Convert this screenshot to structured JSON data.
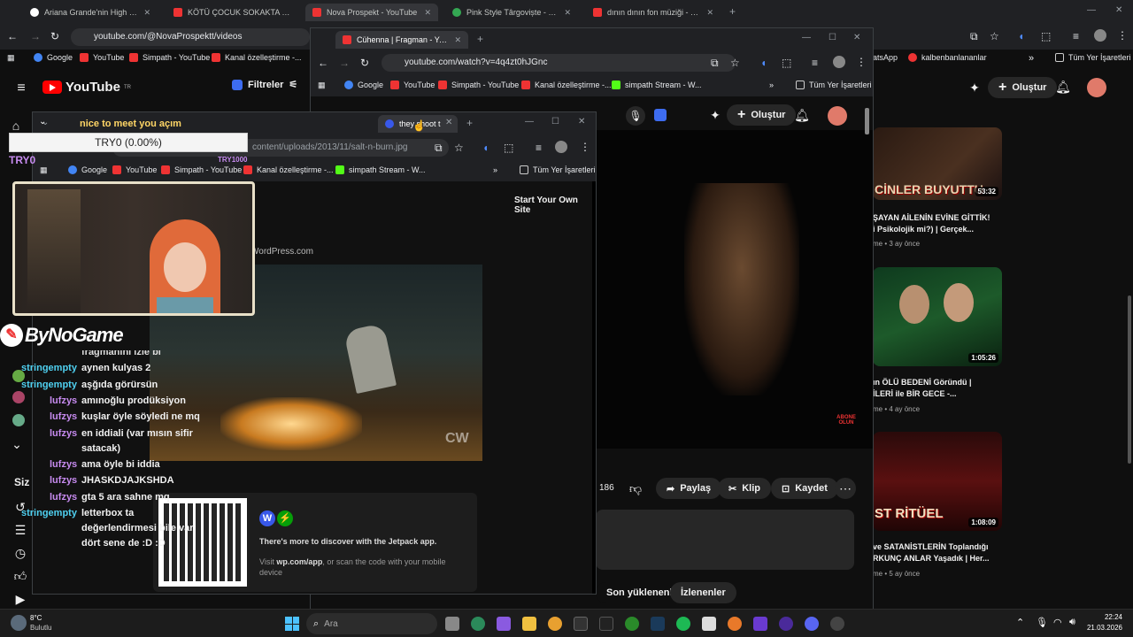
{
  "tabs": [
    {
      "label": "Ariana Grande'nin High Note P"
    },
    {
      "label": "KÖTÜ ÇOCUK SOKAKTA VE TAF"
    },
    {
      "label": "Nova Prospekt - YouTube"
    },
    {
      "label": "Pink Style Târgoviște - Google I"
    },
    {
      "label": "dının dının fon müziği - YouTub"
    }
  ],
  "main_url": "youtube.com/@NovaProspektt/videos",
  "bookmarks": [
    "Google",
    "YouTube",
    "Simpath - YouTube",
    "Kanal özelleştirme -..."
  ],
  "right_bookmarks": [
    "atsApp",
    "kalbenbanlananlar",
    "Tüm Yer İşaretleri"
  ],
  "yt": {
    "logo": "YouTube",
    "region": "TR",
    "filters": "Filtreler",
    "create": "Oluştur",
    "you_section": "Siz"
  },
  "win2": {
    "tab": "Cühenna | Fragman - YouTube",
    "url": "youtube.com/watch?v=4q4zt0hJGnc",
    "bookmarks": [
      "Google",
      "YouTube",
      "Simpath - YouTube",
      "Kanal özelleştirme -...",
      "simpath Stream - W..."
    ],
    "all_bookmarks": "Tüm Yer İşaretleri",
    "create": "Oluştur",
    "actions": {
      "likes": "186",
      "share": "Paylaş",
      "clip": "Klip",
      "save": "Kaydet"
    },
    "chips": [
      "Son yüklenenler",
      "İzlenenler"
    ],
    "video_badge": "ABONE OLUN"
  },
  "win3": {
    "tab": "they shoot t",
    "url": "content/uploads/2013/11/salt-n-burn.jpg",
    "bookmarks": [
      "Google",
      "YouTube",
      "Simpath - YouTube",
      "Kanal özelleştirme -...",
      "simpath Stream - W..."
    ],
    "all_bookmarks": "Tüm Yer İşaretleri",
    "start_site": "Start Your Own Site",
    "wp_text": "WordPress.com",
    "cw": "CW",
    "jetpack_title": "There's more to discover with the Jetpack app.",
    "jetpack_visit": "Visit",
    "jetpack_link": "wp.com/app",
    "jetpack_rest": ", or scan the code with your mobile device"
  },
  "overlay": {
    "greeting": "nice to meet you açım",
    "goal": "TRY0 (0.00%)",
    "goal_left": "TRY0",
    "goal_right": "TRY1000",
    "brand": "ByNoGame"
  },
  "chat": [
    {
      "user": "",
      "msg": "fragmanini izle bi"
    },
    {
      "user": "stringempty",
      "msg": "aynen kulyas 2"
    },
    {
      "user": "stringempty",
      "msg": "aşğıda görürsün"
    },
    {
      "user": "lufzys",
      "msg": "amınoğlu prodüksiyon"
    },
    {
      "user": "lufzys",
      "msg": "kuşlar öyle söyledi ne mq"
    },
    {
      "user": "lufzys",
      "msg": "en iddiali (var mısın sifir"
    },
    {
      "user": "",
      "msg": "satacak)"
    },
    {
      "user": "lufzys",
      "msg": "ama öyle bi iddia"
    },
    {
      "user": "lufzys",
      "msg": "JHASKDJAJKSHDA"
    },
    {
      "user": "lufzys",
      "msg": "gta 5 ara sahne mq"
    },
    {
      "user": "stringempty",
      "msg": "letterbox ta"
    },
    {
      "user": "",
      "msg": "değerlendirmesi bile var"
    },
    {
      "user": "",
      "msg": "dört sene de :D :D"
    }
  ],
  "related": [
    {
      "thumb_text": "CİNLER BUYUTTU",
      "duration": "53:32",
      "title1": "ŞAYAN AİLENİN EVİNE GİTTİK!",
      "title2": "i Psikolojik mi?) | Gerçek...",
      "meta": "me • 3 ay önce"
    },
    {
      "thumb_text": "",
      "duration": "1:05:26",
      "title1": "ın ÖLÜ BEDENİ Göründü |",
      "title2": "İLERİ ile BİR GECE -...",
      "meta": "me • 4 ay önce"
    },
    {
      "thumb_text": "ST RİTÜEL",
      "duration": "1:08:09",
      "title1": "ve SATANİSTLERİN Toplandığı",
      "title2": "RKUNÇ ANLAR Yaşadık | Her...",
      "meta": "me • 5 ay önce"
    }
  ],
  "taskbar": {
    "temp": "8°C",
    "weather": "Bulutlu",
    "search": "Ara",
    "time": "22:24",
    "date": "21.03.2026"
  }
}
